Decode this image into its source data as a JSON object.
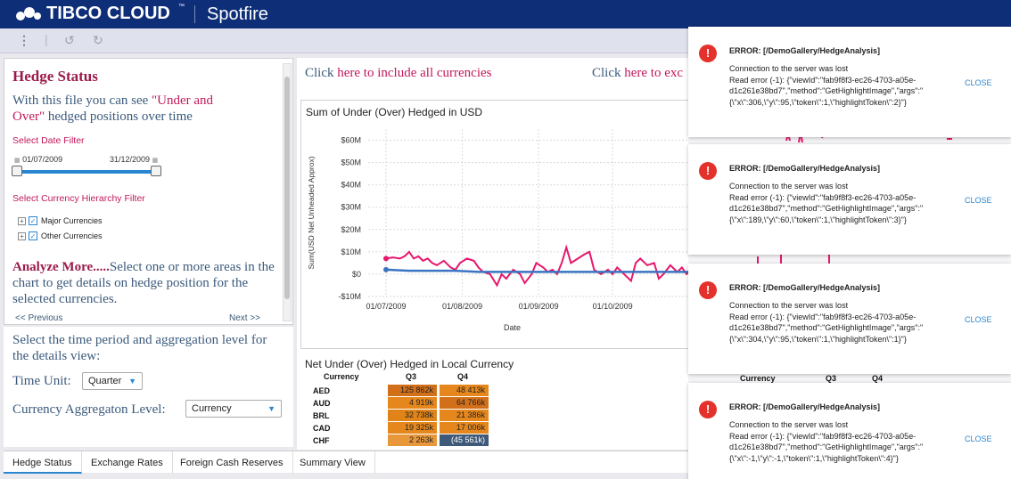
{
  "header": {
    "brand": "TIBCO CLOUD",
    "brand_tm": "™",
    "product": "Spotfire"
  },
  "toolbar": {
    "menu_icon": "vertical-dots-icon",
    "undo_icon": "undo-icon",
    "redo_icon": "redo-icon"
  },
  "left_panel": {
    "title": "Hedge Status",
    "desc_prefix": "With this file you can see ",
    "desc_highlight": "\"Under and Over\"",
    "desc_suffix": " hedged positions over time",
    "date_filter_label": "Select Date Filter",
    "date_start": "01/07/2009",
    "date_end": "31/12/2009",
    "currency_filter_label": "Select Currency Hierarchy Filter",
    "tree": [
      "Major Currencies",
      "Other Currencies"
    ],
    "analyze_bold": "Analyze More.....",
    "analyze_text": "Select one or more areas in the chart to get details on hedge position for the selected currencies.",
    "prev": "<< Previous",
    "next": "Next >>"
  },
  "left_lower": {
    "text": "Select the time period and aggregation level for the details view:",
    "time_unit_label": "Time Unit:",
    "time_unit_value": "Quarter",
    "aggregation_label": "Currency Aggregaton Level:",
    "aggregation_value": "Currency"
  },
  "links": {
    "include_prefix": "Click ",
    "include_link": "here to include all currencies",
    "exclude_prefix": "Click ",
    "exclude_link": "here to exc"
  },
  "chart_data": {
    "type": "line",
    "title": "Sum of Under (Over) Hedged in USD",
    "xlabel": "Date",
    "ylabel": "Sum(USD Net Unheaded Approx)",
    "y_ticks": [
      "$60M",
      "$50M",
      "$40M",
      "$30M",
      "$20M",
      "$10M",
      "$0",
      "-$10M"
    ],
    "x_ticks": [
      "01/07/2009",
      "01/08/2009",
      "01/09/2009",
      "01/10/2009"
    ],
    "ylim": [
      -10,
      65
    ],
    "grid": true,
    "series": [
      {
        "color": "#e6176d",
        "x": [
          0,
          3,
          6,
          8,
          10,
          12,
          14,
          16,
          18,
          20,
          22,
          25,
          28,
          30,
          32,
          35,
          38,
          40,
          42,
          45,
          48,
          50,
          52,
          55,
          58,
          60,
          63,
          65,
          68,
          70,
          72,
          74,
          76,
          78,
          80,
          83,
          86,
          88,
          90,
          93,
          96,
          98,
          100,
          103,
          106,
          108,
          110,
          113,
          116,
          118,
          120,
          123,
          126,
          128,
          130,
          133,
          136,
          138,
          140
        ],
        "y": [
          7,
          7.5,
          7,
          8,
          10,
          7,
          8,
          6,
          7,
          5,
          4,
          6,
          3,
          2,
          5,
          7,
          6,
          3,
          1,
          0,
          -5,
          0,
          -2,
          2,
          0,
          -4,
          0,
          5,
          3,
          1,
          2,
          0,
          5,
          12,
          5,
          7,
          9,
          10,
          2,
          0,
          2,
          0,
          3,
          0,
          -3,
          5,
          7,
          4,
          5,
          -2,
          0,
          4,
          1,
          3,
          0,
          2,
          1,
          3,
          2
        ]
      },
      {
        "color": "#3a74c1",
        "x": [
          0,
          10,
          20,
          30,
          40,
          50,
          60,
          70,
          80,
          90,
          100,
          110,
          120,
          130,
          140
        ],
        "y": [
          2,
          1.5,
          1.5,
          1.5,
          1,
          1,
          1,
          1,
          1,
          1,
          1,
          1,
          1,
          1,
          1
        ]
      }
    ]
  },
  "table": {
    "title": "Net Under (Over) Hedged in Local Currency",
    "headers": [
      "Currency",
      "Q3",
      "Q4"
    ],
    "rows": [
      {
        "currency": "AED",
        "q3": "125 862k",
        "q4": "48 413k",
        "q3_color": "#d2701a",
        "q4_color": "#e5871c"
      },
      {
        "currency": "AUD",
        "q3": "4 919k",
        "q4": "64 766k",
        "q3_color": "#e5871c",
        "q4_color": "#d2701a"
      },
      {
        "currency": "BRL",
        "q3": "32 738k",
        "q4": "21 386k",
        "q3_color": "#e08318",
        "q4_color": "#e5871c"
      },
      {
        "currency": "CAD",
        "q3": "19 325k",
        "q4": "17 006k",
        "q3_color": "#e5871c",
        "q4_color": "#e5871c"
      },
      {
        "currency": "CHF",
        "q3": "2 263k",
        "q4": "(45 561k)",
        "q3_color": "#e8973a",
        "q4_color": "#3f5a78"
      }
    ]
  },
  "tabs": [
    "Hedge Status",
    "Exchange Rates",
    "Foreign Cash Reserves",
    "Summary View"
  ],
  "errors": [
    {
      "title": "ERROR: [/DemoGallery/HedgeAnalysis]",
      "body": "Connection to the server was lost\nRead error (-1): {\"viewId\":\"fab9f8f3-ec26-4703-a05e-d1c261e38bd7\",\"method\":\"GetHighlightImage\",\"args\":\"{\\\"x\\\":306,\\\"y\\\":95,\\\"token\\\":1,\\\"highlightToken\\\":2}\"}",
      "close": "CLOSE"
    },
    {
      "title": "ERROR: [/DemoGallery/HedgeAnalysis]",
      "body": "Connection to the server was lost\nRead error (-1): {\"viewId\":\"fab9f8f3-ec26-4703-a05e-d1c261e38bd7\",\"method\":\"GetHighlightImage\",\"args\":\"{\\\"x\\\":189,\\\"y\\\":60,\\\"token\\\":1,\\\"highlightToken\\\":3}\"}",
      "close": "CLOSE"
    },
    {
      "title": "ERROR: [/DemoGallery/HedgeAnalysis]",
      "body": "Connection to the server was lost\nRead error (-1): {\"viewId\":\"fab9f8f3-ec26-4703-a05e-d1c261e38bd7\",\"method\":\"GetHighlightImage\",\"args\":\"{\\\"x\\\":304,\\\"y\\\":95,\\\"token\\\":1,\\\"highlightToken\\\":1}\"}",
      "close": "CLOSE"
    },
    {
      "title": "ERROR: [/DemoGallery/HedgeAnalysis]",
      "body": "Connection to the server was lost\nRead error (-1): {\"viewId\":\"fab9f8f3-ec26-4703-a05e-d1c261e38bd7\",\"method\":\"GetHighlightImage\",\"args\":\"{\\\"x\\\":-1,\\\"y\\\":-1,\\\"token\\\":1,\\\"highlightToken\\\":4}\"}",
      "close": "CLOSE"
    }
  ],
  "bg_fragments": {
    "currency": "Currency",
    "q3": "Q3",
    "q4": "Q4"
  }
}
